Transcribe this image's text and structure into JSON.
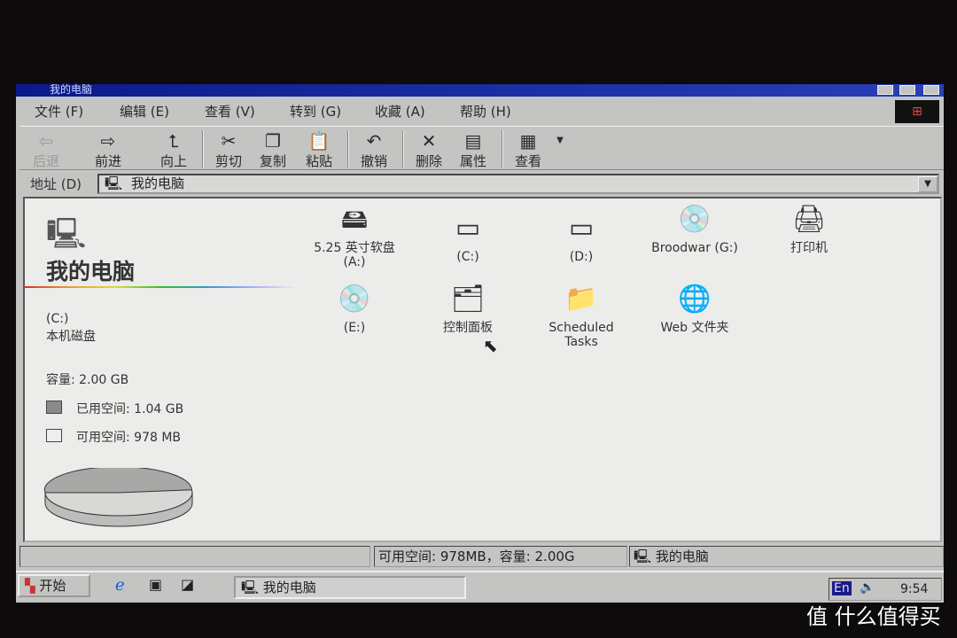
{
  "window": {
    "title": "我的电脑"
  },
  "menu": [
    "文件 (F)",
    "编辑 (E)",
    "查看 (V)",
    "转到 (G)",
    "收藏 (A)",
    "帮助 (H)"
  ],
  "toolbar": {
    "back": "后退",
    "forward": "前进",
    "up": "向上",
    "cut": "剪切",
    "copy": "复制",
    "paste": "粘贴",
    "undo": "撤销",
    "delete": "删除",
    "properties": "属性",
    "views": "查看"
  },
  "address": {
    "label": "地址 (D)",
    "value": "我的电脑"
  },
  "left_panel": {
    "title": "我的电脑",
    "drive": "(C:)",
    "drive_type": "本机磁盘",
    "capacity": "容量: 2.00 GB",
    "used": "已用空间: 1.04 GB",
    "free": "可用空间: 978 MB",
    "used_fraction": 0.52
  },
  "items": [
    {
      "label": "5.25 英寸软盘 (A:)",
      "icon": "floppy-drive-icon"
    },
    {
      "label": "(C:)",
      "icon": "hard-drive-icon"
    },
    {
      "label": "(D:)",
      "icon": "hard-drive-icon"
    },
    {
      "label": "Broodwar (G:)",
      "icon": "cd-drive-icon"
    },
    {
      "label": "打印机",
      "icon": "printers-folder-icon"
    },
    {
      "label": "(E:)",
      "icon": "cd-drive-icon"
    },
    {
      "label": "控制面板",
      "icon": "control-panel-icon"
    },
    {
      "label": "Scheduled Tasks",
      "icon": "scheduled-tasks-icon"
    },
    {
      "label": "Web 文件夹",
      "icon": "web-folder-icon"
    }
  ],
  "status": {
    "info": "可用空间: 978MB，容量: 2.00G",
    "location": "我的电脑"
  },
  "taskbar": {
    "start": "开始",
    "task": "我的电脑",
    "ime": "En",
    "clock": "9:54"
  },
  "watermark": "值 什么值得买"
}
